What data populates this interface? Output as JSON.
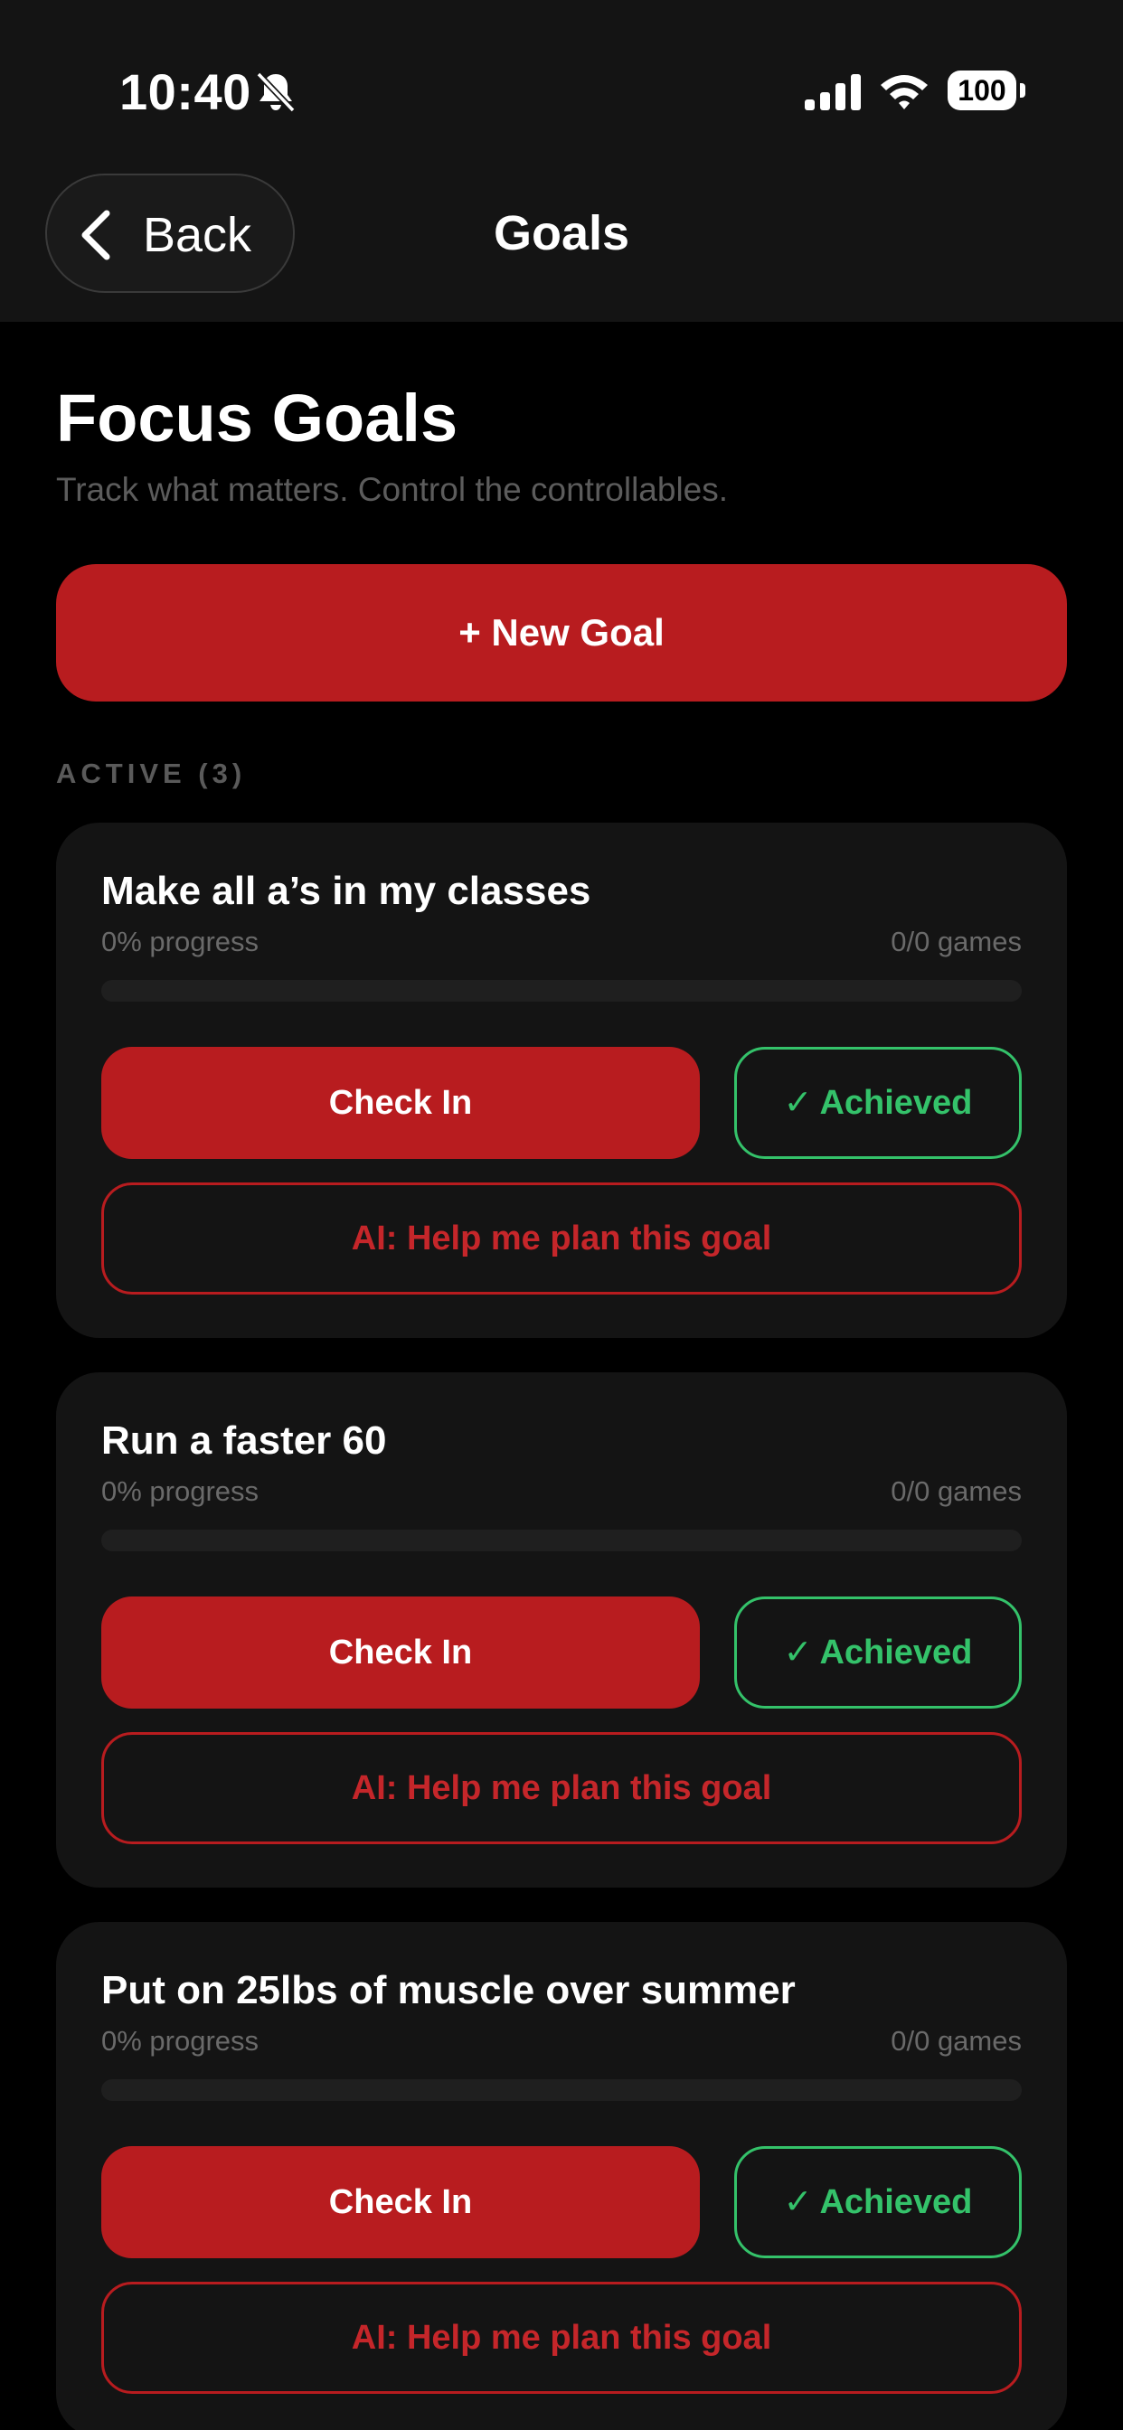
{
  "status_bar": {
    "time": "10:40",
    "battery": "100"
  },
  "nav": {
    "back_label": "Back",
    "title": "Goals"
  },
  "page": {
    "title": "Focus Goals",
    "subtitle": "Track what matters. Control the controllables.",
    "new_goal_label": "+ New Goal",
    "section_label": "ACTIVE (3)"
  },
  "goals": [
    {
      "title": "Make all a’s in my classes",
      "progress_text": "0% progress",
      "progress_fraction": 0,
      "games_text": "0/0 games",
      "checkin_label": "Check In",
      "achieved_label": "Achieved",
      "ai_label": "AI: Help me plan this goal"
    },
    {
      "title": "Run a faster 60",
      "progress_text": "0% progress",
      "progress_fraction": 0,
      "games_text": "0/0 games",
      "checkin_label": "Check In",
      "achieved_label": "Achieved",
      "ai_label": "AI: Help me plan this goal"
    },
    {
      "title": "Put on 25lbs of muscle over summer",
      "progress_text": "0% progress",
      "progress_fraction": 0,
      "games_text": "0/0 games",
      "checkin_label": "Check In",
      "achieved_label": "Achieved",
      "ai_label": "AI: Help me plan this goal"
    }
  ],
  "colors": {
    "accent_red": "#b81c1f",
    "achieved_green": "#34c26a",
    "card_bg": "#141414",
    "page_bg": "#000000"
  },
  "icons": {
    "back": "chevron-left-icon",
    "silent": "bell-slash-icon",
    "signal": "cellular-signal-icon",
    "wifi": "wifi-icon",
    "check": "checkmark-icon"
  }
}
